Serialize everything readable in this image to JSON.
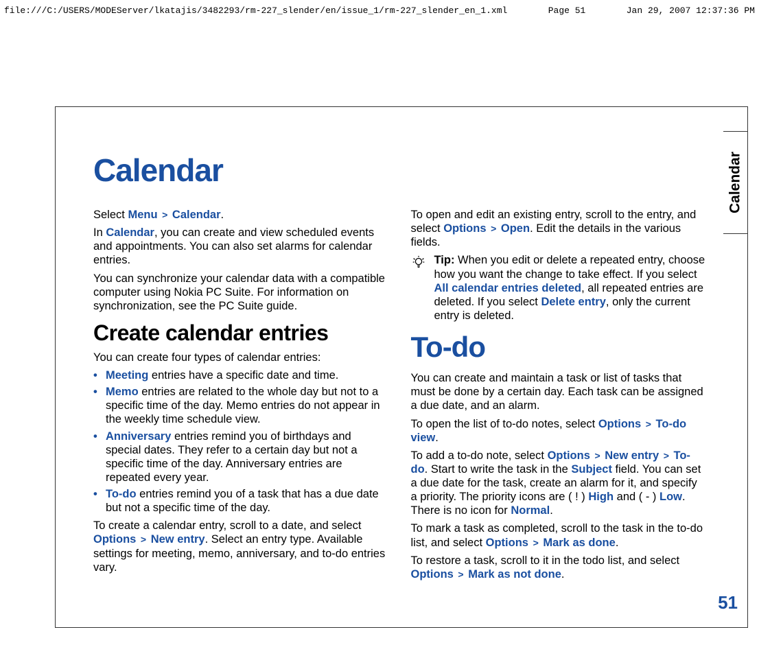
{
  "header": {
    "path": "file:///C:/USERS/MODEServer/lkatajis/3482293/rm-227_slender/en/issue_1/rm-227_slender_en_1.xml",
    "page": "Page 51",
    "timestamp": "Jan 29, 2007 12:37:36 PM"
  },
  "tab_label": "Calendar",
  "page_number": "51",
  "title": "Calendar",
  "intro": {
    "l1a": "Select ",
    "menu": "Menu",
    "gt": ">",
    "calendar": "Calendar",
    "l1b": ".",
    "p2a": "In ",
    "p2b": ", you can create and view scheduled events and appointments. You can also set alarms for calendar entries.",
    "p3": "You can synchronize your calendar data with a compatible computer using Nokia PC Suite. For information on synchronization, see the PC Suite guide."
  },
  "sec1": {
    "heading": "Create calendar entries",
    "lead": "You can create four types of calendar entries:",
    "items": [
      {
        "b": "Meeting",
        "t": " entries have a specific date and time."
      },
      {
        "b": "Memo",
        "t": " entries are related to the whole day but not to a specific time of the day. Memo entries do not appear in the weekly time schedule view."
      },
      {
        "b": "Anniversary",
        "t": " entries remind you of birthdays and special dates. They refer to a certain day but not a specific time of the day. Anniversary entries are repeated every year."
      },
      {
        "b": "To-do",
        "t": " entries remind you of a task that has a due date but not a specific time of the day."
      }
    ],
    "p_after_a": "To create a calendar entry, scroll to a date, and select ",
    "options": "Options",
    "newentry": "New entry",
    "p_after_b": ". Select an entry type. Available settings for meeting, memo, anniversary, and to-do entries vary."
  },
  "col2": {
    "open_a": "To open and edit an existing entry, scroll to the entry, and select ",
    "open_opt": "Options",
    "open_cmd": "Open",
    "open_b": ". Edit the details in the various fields.",
    "tip_label": "Tip:  ",
    "tip_a": "When you edit or delete a repeated entry, choose how you want the change to take effect. If you select ",
    "tip_all": "All calendar entries deleted",
    "tip_b": ", all repeated entries are deleted. If you select ",
    "tip_del": "Delete entry",
    "tip_c": ", only the current entry is deleted."
  },
  "todo": {
    "heading": "To-do",
    "p1": "You can create and maintain a task or list of tasks that must be done by a certain day. Each task can be assigned a due date, and an alarm.",
    "p2a": "To open the list of to-do notes, select ",
    "p2_opt": "Options",
    "p2_view": "To-do view",
    "p2b": ".",
    "p3a": "To add a to-do note, select ",
    "p3_opt": "Options",
    "p3_new": "New entry",
    "p3_todo": "To-do",
    "p3b": ". Start to write the task in the ",
    "p3_subj": "Subject",
    "p3c": " field. You can set a due date for the task, create an alarm for it, and specify a priority. The priority icons are ( ! ) ",
    "p3_high": "High",
    "p3d": " and ( - ) ",
    "p3_low": "Low",
    "p3e": ". There is no icon for ",
    "p3_norm": "Normal",
    "p3f": ".",
    "p4a": "To mark a task as completed, scroll to the task in the to-do list, and select ",
    "p4_opt": "Options",
    "p4_cmd": "Mark as done",
    "p4b": ".",
    "p5a": "To restore a task, scroll to it in the todo list, and select ",
    "p5_opt": "Options",
    "p5_cmd": "Mark as not done",
    "p5b": "."
  }
}
